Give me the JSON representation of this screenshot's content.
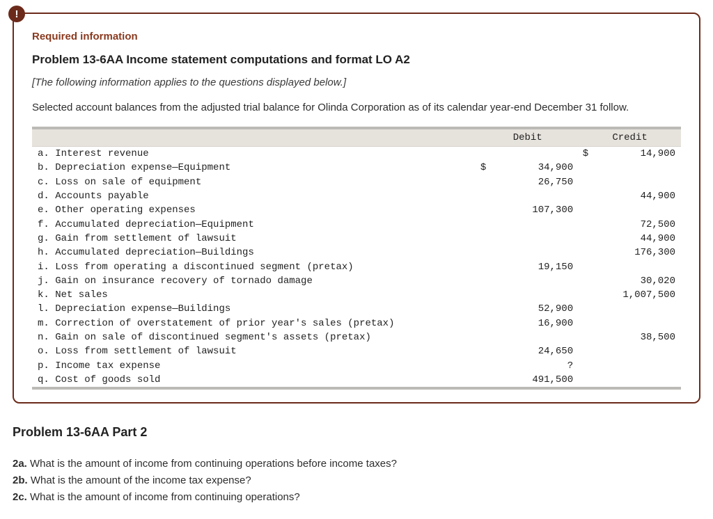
{
  "badge": "!",
  "required_label": "Required information",
  "problem_title": "Problem 13-6AA Income statement computations and format LO A2",
  "applies_text": "[The following information applies to the questions displayed below.]",
  "intro_text": "Selected account balances from the adjusted trial balance for Olinda Corporation as of its calendar year-end December 31 follow.",
  "columns": {
    "debit": "Debit",
    "credit": "Credit"
  },
  "rows": [
    {
      "l": "a. Interest revenue",
      "d": "",
      "c": "14,900",
      "cs": "$"
    },
    {
      "l": "b. Depreciation expense—Equipment",
      "d": "34,900",
      "ds": "$",
      "c": ""
    },
    {
      "l": "c. Loss on sale of equipment",
      "d": "26,750",
      "c": ""
    },
    {
      "l": "d. Accounts payable",
      "d": "",
      "c": "44,900"
    },
    {
      "l": "e. Other operating expenses",
      "d": "107,300",
      "c": ""
    },
    {
      "l": "f. Accumulated depreciation—Equipment",
      "d": "",
      "c": "72,500"
    },
    {
      "l": "g. Gain from settlement of lawsuit",
      "d": "",
      "c": "44,900"
    },
    {
      "l": "h. Accumulated depreciation—Buildings",
      "d": "",
      "c": "176,300"
    },
    {
      "l": "i. Loss from operating a discontinued segment (pretax)",
      "d": "19,150",
      "c": ""
    },
    {
      "l": "j. Gain on insurance recovery of tornado damage",
      "d": "",
      "c": "30,020"
    },
    {
      "l": "k. Net sales",
      "d": "",
      "c": "1,007,500"
    },
    {
      "l": "l. Depreciation expense—Buildings",
      "d": "52,900",
      "c": ""
    },
    {
      "l": "m. Correction of overstatement of prior year's sales (pretax)",
      "d": "16,900",
      "c": ""
    },
    {
      "l": "n. Gain on sale of discontinued segment's assets (pretax)",
      "d": "",
      "c": "38,500"
    },
    {
      "l": "o. Loss from settlement of lawsuit",
      "d": "24,650",
      "c": ""
    },
    {
      "l": "p. Income tax expense",
      "d": "?",
      "c": ""
    },
    {
      "l": "q. Cost of goods sold",
      "d": "491,500",
      "c": ""
    }
  ],
  "part2_title": "Problem 13-6AA Part 2",
  "questions": [
    {
      "n": "2a.",
      "t": "What is the amount of income from continuing operations before income taxes?"
    },
    {
      "n": "2b.",
      "t": "What is the amount of the income tax expense?"
    },
    {
      "n": "2c.",
      "t": "What is the amount of income from continuing operations?"
    }
  ]
}
